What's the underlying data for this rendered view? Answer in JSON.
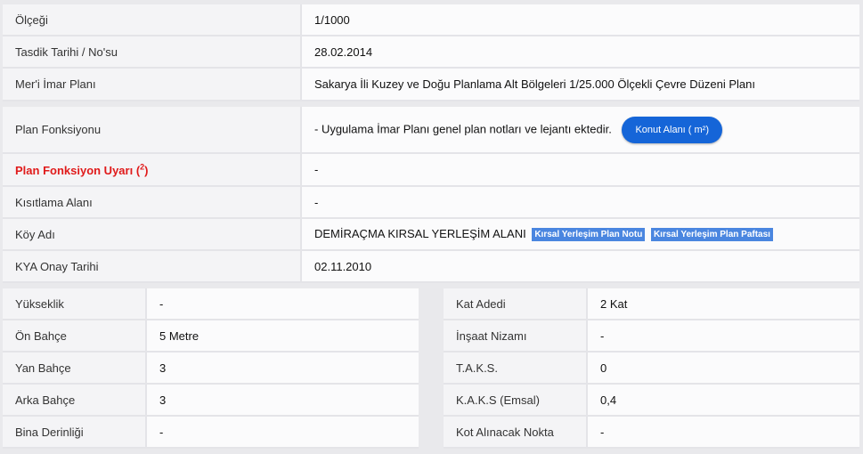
{
  "top_rows": [
    {
      "label": "Ölçeği",
      "value": "1/1000"
    },
    {
      "label": "Tasdik Tarihi / No'su",
      "value": "28.02.2014"
    },
    {
      "label": "Mer'i İmar Planı",
      "value": "Sakarya İli Kuzey ve Doğu Planlama Alt Bölgeleri 1/25.000 Ölçekli Çevre Düzeni Planı"
    }
  ],
  "plan": {
    "label": "Plan Fonksiyonu",
    "value": "- Uygulama İmar Planı genel plan notları ve lejantı ektedir.",
    "button": "Konut Alanı ( m²)"
  },
  "warning": {
    "label": "Plan Fonksiyon Uyarı (",
    "sup": "2",
    "label_end": ")",
    "value": "-"
  },
  "restriction": {
    "label": "Kısıtlama Alanı",
    "value": "-"
  },
  "village": {
    "label": "Köy Adı",
    "value": "DEMİRAÇMA KIRSAL YERLEŞİM ALANI",
    "tag1": "Kırsal Yerleşim Plan Notu",
    "tag2": "Kırsal Yerleşim Plan Paftası"
  },
  "kya": {
    "label": "KYA Onay Tarihi",
    "value": "02.11.2010"
  },
  "left_grid": [
    {
      "label": "Yükseklik",
      "value": "-"
    },
    {
      "label": "Ön Bahçe",
      "value": "5 Metre"
    },
    {
      "label": "Yan Bahçe",
      "value": "3"
    },
    {
      "label": "Arka Bahçe",
      "value": "3"
    },
    {
      "label": "Bina Derinliği",
      "value": "-"
    }
  ],
  "right_grid": [
    {
      "label": "Kat Adedi",
      "value": "2 Kat"
    },
    {
      "label": "İnşaat Nizamı",
      "value": "-"
    },
    {
      "label": "T.A.K.S.",
      "value": "0"
    },
    {
      "label": "K.A.K.S (Emsal)",
      "value": "0,4"
    },
    {
      "label": "Kot Alınacak Nokta",
      "value": "-"
    }
  ]
}
